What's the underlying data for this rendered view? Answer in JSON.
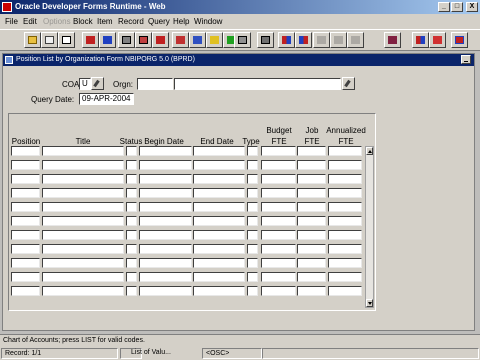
{
  "window": {
    "title": "Oracle Developer Forms Runtime - Web",
    "controls": {
      "minimize": "_",
      "maximize": "□",
      "close": "X"
    }
  },
  "menu": {
    "items": [
      "File",
      "Edit",
      "Options",
      "Block",
      "Item",
      "Record",
      "Query",
      "Help",
      "Window"
    ]
  },
  "toolbar": {
    "buttons": [
      "save-icon",
      "print-icon",
      "exit-icon",
      "cut-icon",
      "copy-icon",
      "paste-icon",
      "enter-query-icon",
      "execute-query-icon",
      "cancel-query-icon",
      "insert-record-icon",
      "remove-record-icon",
      "lock-record-icon",
      "clear-record-icon",
      "list-of-values-icon",
      "edit-field-icon",
      "prev-block-icon",
      "next-block-icon",
      "prev-record-icon",
      "next-record-icon",
      "help-icon",
      "book-icon",
      "options-icon",
      "exit-door-icon"
    ]
  },
  "form": {
    "title": "Position List by Organization Form  NBIPORG  5.0  (BPRD)",
    "coa_label": "COA:",
    "coa_value": "U",
    "orgn_label": "Orgn:",
    "orgn_value": "",
    "orgn_desc": "",
    "query_date_label": "Query Date:",
    "query_date_value": "09-APR-2004"
  },
  "table": {
    "columns": {
      "position": "Position",
      "title": "Title",
      "status": "Status",
      "begin_date": "Begin Date",
      "end_date": "End Date",
      "type": "Type",
      "budget_fte_1": "Budget",
      "budget_fte_2": "FTE",
      "job_fte_1": "Job",
      "job_fte_2": "FTE",
      "annualized_fte_1": "Annualized",
      "annualized_fte_2": "FTE"
    },
    "row_count": 11
  },
  "hint": "Chart of Accounts; press LIST for valid codes.",
  "status": {
    "record": "Record: 1/1",
    "list": "List of Valu...",
    "osc": "<OSC>"
  }
}
